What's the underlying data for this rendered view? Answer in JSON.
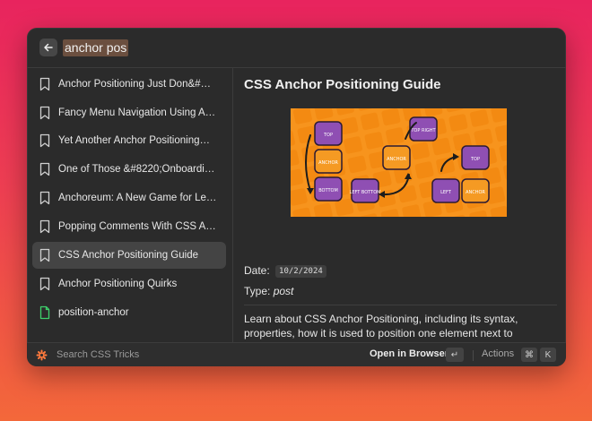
{
  "search": {
    "query": "anchor pos"
  },
  "results": [
    {
      "label": "Anchor Positioning Just Don&#…",
      "icon": "bookmark-icon"
    },
    {
      "label": "Fancy Menu Navigation Using A…",
      "icon": "bookmark-icon"
    },
    {
      "label": "Yet Another Anchor Positioning…",
      "icon": "bookmark-icon"
    },
    {
      "label": "One of Those &#8220;Onboardi…",
      "icon": "bookmark-icon"
    },
    {
      "label": "Anchoreum: A New Game for Le…",
      "icon": "bookmark-icon"
    },
    {
      "label": "Popping Comments With CSS A…",
      "icon": "bookmark-icon"
    },
    {
      "label": "CSS Anchor Positioning Guide",
      "icon": "bookmark-icon",
      "selected": true
    },
    {
      "label": "Anchor Positioning Quirks",
      "icon": "bookmark-icon"
    },
    {
      "label": "position-anchor",
      "icon": "document-icon"
    }
  ],
  "detail": {
    "title": "CSS Anchor Positioning Guide",
    "image": {
      "boxes": {
        "top": "TOP",
        "anchor1": "ANCHOR",
        "bottom": "BOTTOM",
        "left_bottom": "LEFT BOTTOM",
        "anchor_center": "ANCHOR",
        "top_right": "TOP RIGHT",
        "top2": "TOP",
        "left": "LEFT",
        "anchor2": "ANCHOR"
      }
    },
    "date_label": "Date:",
    "date_value": "10/2/2024",
    "type_label": "Type:",
    "type_value": "post",
    "description": "Learn about CSS Anchor Positioning, including its syntax, properties, how it is used to position one element next to another, and even how it's used to resize elements relative to other elements."
  },
  "footer": {
    "hint": "Search CSS Tricks",
    "open_label": "Open in Browser",
    "enter_key": "↵",
    "actions_label": "Actions",
    "cmd_key": "⌘",
    "k_key": "K"
  },
  "colors": {
    "selected_row": "#444444",
    "image_bg": "#f7941d",
    "purple_box": "#8f4fb3",
    "orange_box": "#f59a23"
  }
}
